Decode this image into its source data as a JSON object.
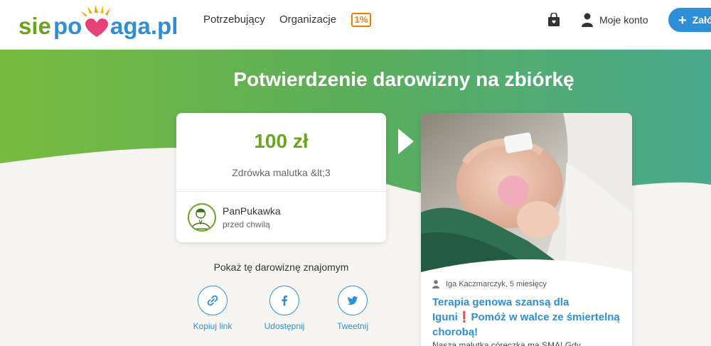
{
  "header": {
    "logo_text": "siepomaga.pl",
    "nav": [
      "Potrzebujący",
      "Organizacje"
    ],
    "one_percent": "1%",
    "account_label": "Moje konto",
    "cta_label": "Załóż"
  },
  "hero": {
    "title": "Potwierdzenie darowizny na zbiórkę"
  },
  "donation": {
    "amount": "100 zł",
    "message": "Zdrówka malutka &lt;3",
    "donor_name": "PanPukawka",
    "donor_time": "przed chwilą"
  },
  "share": {
    "label": "Pokaż tę darowiznę znajomym",
    "buttons": [
      "Kopiuj link",
      "Udostępnij",
      "Tweetnij"
    ]
  },
  "fundraiser": {
    "author": "Iga Kaczmarczyk, 5 miesięcy",
    "title": "Terapia genowa szansą dla Iguni❗Pomóż w walce ze śmiertelną chorobą!",
    "description": "Nasza malutka córeczka ma SMA! Gdy"
  },
  "colors": {
    "brand_green": "#6aa61b",
    "brand_blue": "#2d8fd7",
    "accent_orange": "#f07d00",
    "logo_pink": "#e8417a"
  },
  "icons": [
    "heart-logo-icon",
    "shopping-bag-icon",
    "user-icon",
    "plus-icon",
    "arrow-right-icon",
    "link-icon",
    "facebook-icon",
    "twitter-icon",
    "person-icon"
  ]
}
